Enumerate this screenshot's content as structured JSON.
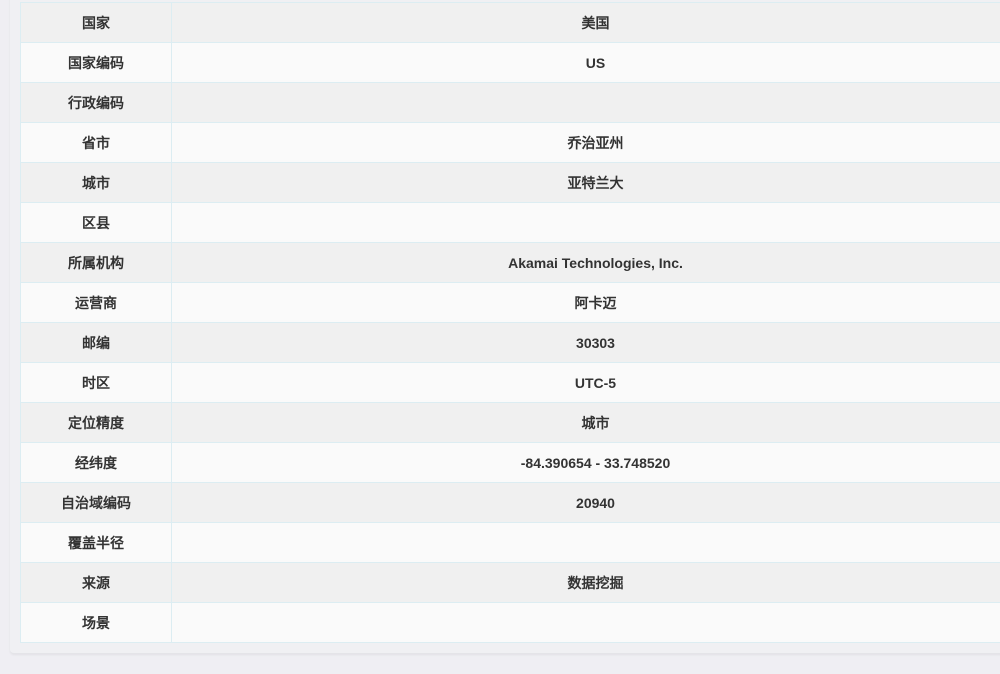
{
  "colors": {
    "page_background": "#efeef3",
    "row_odd": "#f0f0f0",
    "row_even": "#fafafa",
    "border": "#dcedf2",
    "text": "#333333"
  },
  "ip_info": {
    "rows": [
      {
        "label": "国家",
        "value": "美国"
      },
      {
        "label": "国家编码",
        "value": "US"
      },
      {
        "label": "行政编码",
        "value": ""
      },
      {
        "label": "省市",
        "value": "乔治亚州"
      },
      {
        "label": "城市",
        "value": "亚特兰大"
      },
      {
        "label": "区县",
        "value": ""
      },
      {
        "label": "所属机构",
        "value": "Akamai Technologies, Inc."
      },
      {
        "label": "运营商",
        "value": "阿卡迈"
      },
      {
        "label": "邮编",
        "value": "30303"
      },
      {
        "label": "时区",
        "value": "UTC-5"
      },
      {
        "label": "定位精度",
        "value": "城市"
      },
      {
        "label": "经纬度",
        "value": "-84.390654 - 33.748520"
      },
      {
        "label": "自治域编码",
        "value": "20940"
      },
      {
        "label": "覆盖半径",
        "value": ""
      },
      {
        "label": "来源",
        "value": "数据挖掘"
      },
      {
        "label": "场景",
        "value": ""
      }
    ]
  }
}
